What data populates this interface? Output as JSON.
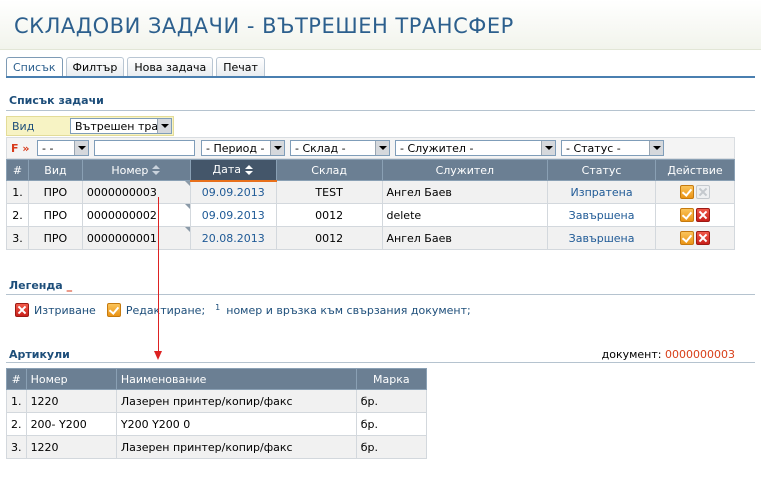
{
  "header": {
    "title": "СКЛАДОВИ ЗАДАЧИ - ВЪТРЕШЕН ТРАНСФЕР"
  },
  "tabs": [
    {
      "label": "Списък",
      "active": true
    },
    {
      "label": "Филтър",
      "active": false
    },
    {
      "label": "Нова задача",
      "active": false
    },
    {
      "label": "Печат",
      "active": false
    }
  ],
  "task_list": {
    "heading": "Списък задачи",
    "vid_label": "Вид",
    "vid_value": "Вътрешен тран",
    "filter_mark": "F »",
    "filters": {
      "vid": "- -",
      "nomer": "",
      "period": "- Период -",
      "sklad": "- Склад -",
      "sluzhitel": "- Служител -",
      "status": "- Статус -"
    },
    "columns": [
      "#",
      "Вид",
      "Номер",
      "Дата",
      "Склад",
      "Служител",
      "Статус",
      "Действие"
    ],
    "rows": [
      {
        "n": "1.",
        "vid": "ПРО",
        "nomer": "0000000003",
        "data": "09.09.2013",
        "sklad": "TEST",
        "sluzhitel": "Ангел Баев",
        "status": "Изпратена",
        "can_delete": false
      },
      {
        "n": "2.",
        "vid": "ПРО",
        "nomer": "0000000002",
        "data": "09.09.2013",
        "sklad": "0012",
        "sluzhitel": "delete",
        "status": "Завършена",
        "can_delete": true
      },
      {
        "n": "3.",
        "vid": "ПРО",
        "nomer": "0000000001",
        "data": "20.08.2013",
        "sklad": "0012",
        "sluzhitel": "Ангел Баев",
        "status": "Завършена",
        "can_delete": true
      }
    ]
  },
  "legend": {
    "heading": "Легенда",
    "dash": "_",
    "delete_label": "Изтриване",
    "edit_label": "Редактиране;",
    "sup": "1",
    "note": "номер и връзка към свързания документ;"
  },
  "articles": {
    "heading": "Артикули",
    "doc_label": "документ:",
    "doc_number": "0000000003",
    "columns": [
      "#",
      "Номер",
      "Наименование",
      "Марка"
    ],
    "rows": [
      {
        "n": "1.",
        "nomer": "1220",
        "name": "Лазерен принтер/копир/факс",
        "marka": "бр."
      },
      {
        "n": "2.",
        "nomer": "200- Y200",
        "name": "Y200  Y200 0",
        "marka": "бр."
      },
      {
        "n": "3.",
        "nomer": "1220",
        "name": "Лазерен принтер/копир/факс",
        "marka": "бр."
      }
    ]
  },
  "colors": {
    "title": "#2c5f8d",
    "header_bg": "#6b7f93",
    "sorted_header_bg": "#44566a",
    "accent": "#e8701b",
    "link": "#1f5a96",
    "doc_number": "#d8401a"
  }
}
